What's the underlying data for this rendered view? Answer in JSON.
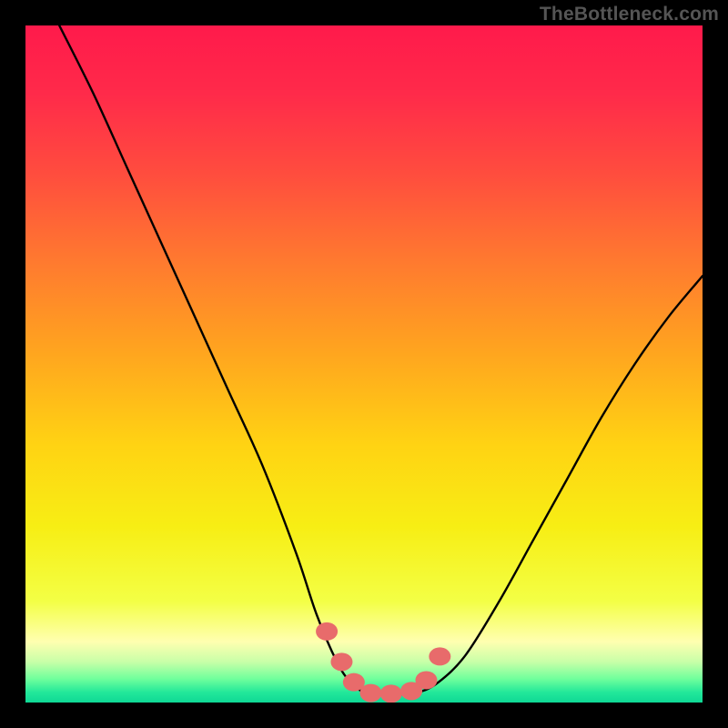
{
  "watermark": "TheBottleneck.com",
  "colors": {
    "frame": "#000000",
    "curve_stroke": "#000000",
    "marker_fill": "#e86b6b",
    "marker_stroke": "#c94f4f",
    "gradient_stops": [
      {
        "offset": 0.0,
        "color": "#ff1a4b"
      },
      {
        "offset": 0.1,
        "color": "#ff2a4a"
      },
      {
        "offset": 0.22,
        "color": "#ff4d3e"
      },
      {
        "offset": 0.35,
        "color": "#ff7a2f"
      },
      {
        "offset": 0.48,
        "color": "#ffa41f"
      },
      {
        "offset": 0.62,
        "color": "#ffd313"
      },
      {
        "offset": 0.74,
        "color": "#f7ee14"
      },
      {
        "offset": 0.85,
        "color": "#f3ff45"
      },
      {
        "offset": 0.91,
        "color": "#ffffb0"
      },
      {
        "offset": 0.94,
        "color": "#c8ffa8"
      },
      {
        "offset": 0.965,
        "color": "#70ff9c"
      },
      {
        "offset": 0.985,
        "color": "#22e89a"
      },
      {
        "offset": 1.0,
        "color": "#0fd895"
      }
    ]
  },
  "chart_data": {
    "type": "line",
    "title": "",
    "xlabel": "",
    "ylabel": "",
    "xlim": [
      0,
      100
    ],
    "ylim": [
      0,
      100
    ],
    "grid": false,
    "legend": false,
    "series": [
      {
        "name": "bottleneck-curve",
        "x": [
          5,
          10,
          15,
          20,
          25,
          30,
          35,
          40,
          43,
          46,
          48,
          50,
          52,
          55,
          58,
          61,
          65,
          70,
          75,
          80,
          85,
          90,
          95,
          100
        ],
        "y": [
          100,
          90,
          79,
          68,
          57,
          46,
          35,
          22,
          13,
          6,
          3,
          1.5,
          1.2,
          1.2,
          1.5,
          3,
          7,
          15,
          24,
          33,
          42,
          50,
          57,
          63
        ]
      }
    ],
    "markers": {
      "name": "highlight-points",
      "x": [
        44.5,
        46.7,
        48.5,
        51.0,
        54.0,
        57.0,
        59.2,
        61.2
      ],
      "y": [
        10.5,
        6.0,
        3.0,
        1.4,
        1.3,
        1.7,
        3.3,
        6.8
      ]
    }
  }
}
